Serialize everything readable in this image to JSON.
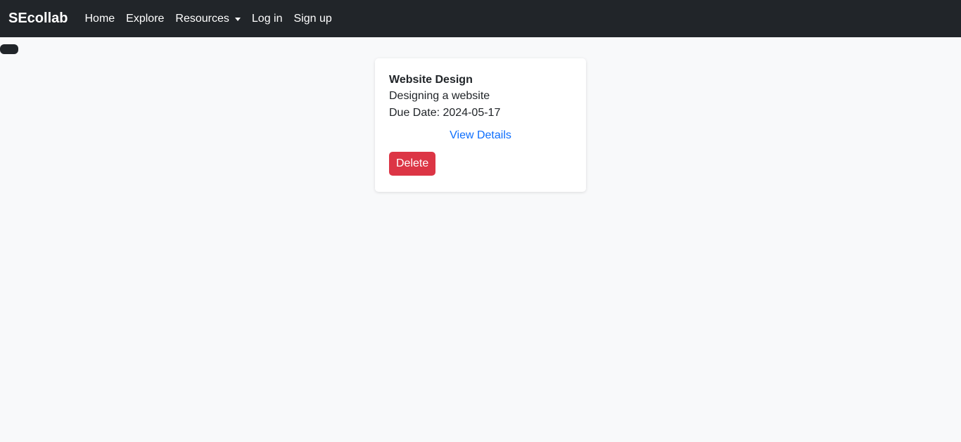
{
  "navbar": {
    "brand": "SEcollab",
    "links": [
      {
        "label": "Home"
      },
      {
        "label": "Explore"
      },
      {
        "label": "Resources"
      },
      {
        "label": "Log in"
      },
      {
        "label": "Sign up"
      }
    ]
  },
  "task_card": {
    "title": "Website Design",
    "description": "Designing a website",
    "due_date_label": "Due Date:",
    "due_date_value": "2024-05-17",
    "view_details_label": "View Details",
    "delete_label": "Delete"
  },
  "colors": {
    "navbar_bg": "#212529",
    "page_bg": "#f8f9fa",
    "link": "#0d6efd",
    "danger": "#dc3545"
  }
}
